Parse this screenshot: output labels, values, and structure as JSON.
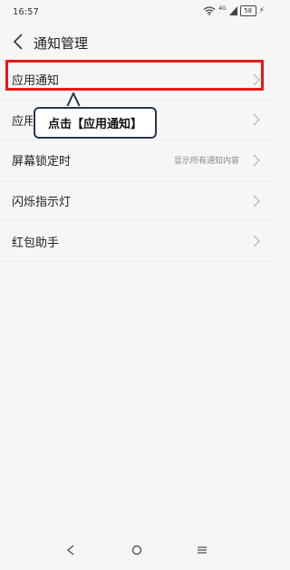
{
  "status": {
    "time": "16:57",
    "network": "4G",
    "battery": "58"
  },
  "header": {
    "title": "通知管理"
  },
  "list": [
    {
      "label": "应用通知",
      "value": ""
    },
    {
      "label": "应用",
      "value": ""
    },
    {
      "label": "屏幕锁定时",
      "value": "显示所有通知内容"
    },
    {
      "label": "闪烁指示灯",
      "value": ""
    },
    {
      "label": "红包助手",
      "value": ""
    }
  ],
  "callout": {
    "text": "点击【应用通知】"
  },
  "colors": {
    "highlight": "#e31a1a",
    "callout_border": "#273449"
  }
}
